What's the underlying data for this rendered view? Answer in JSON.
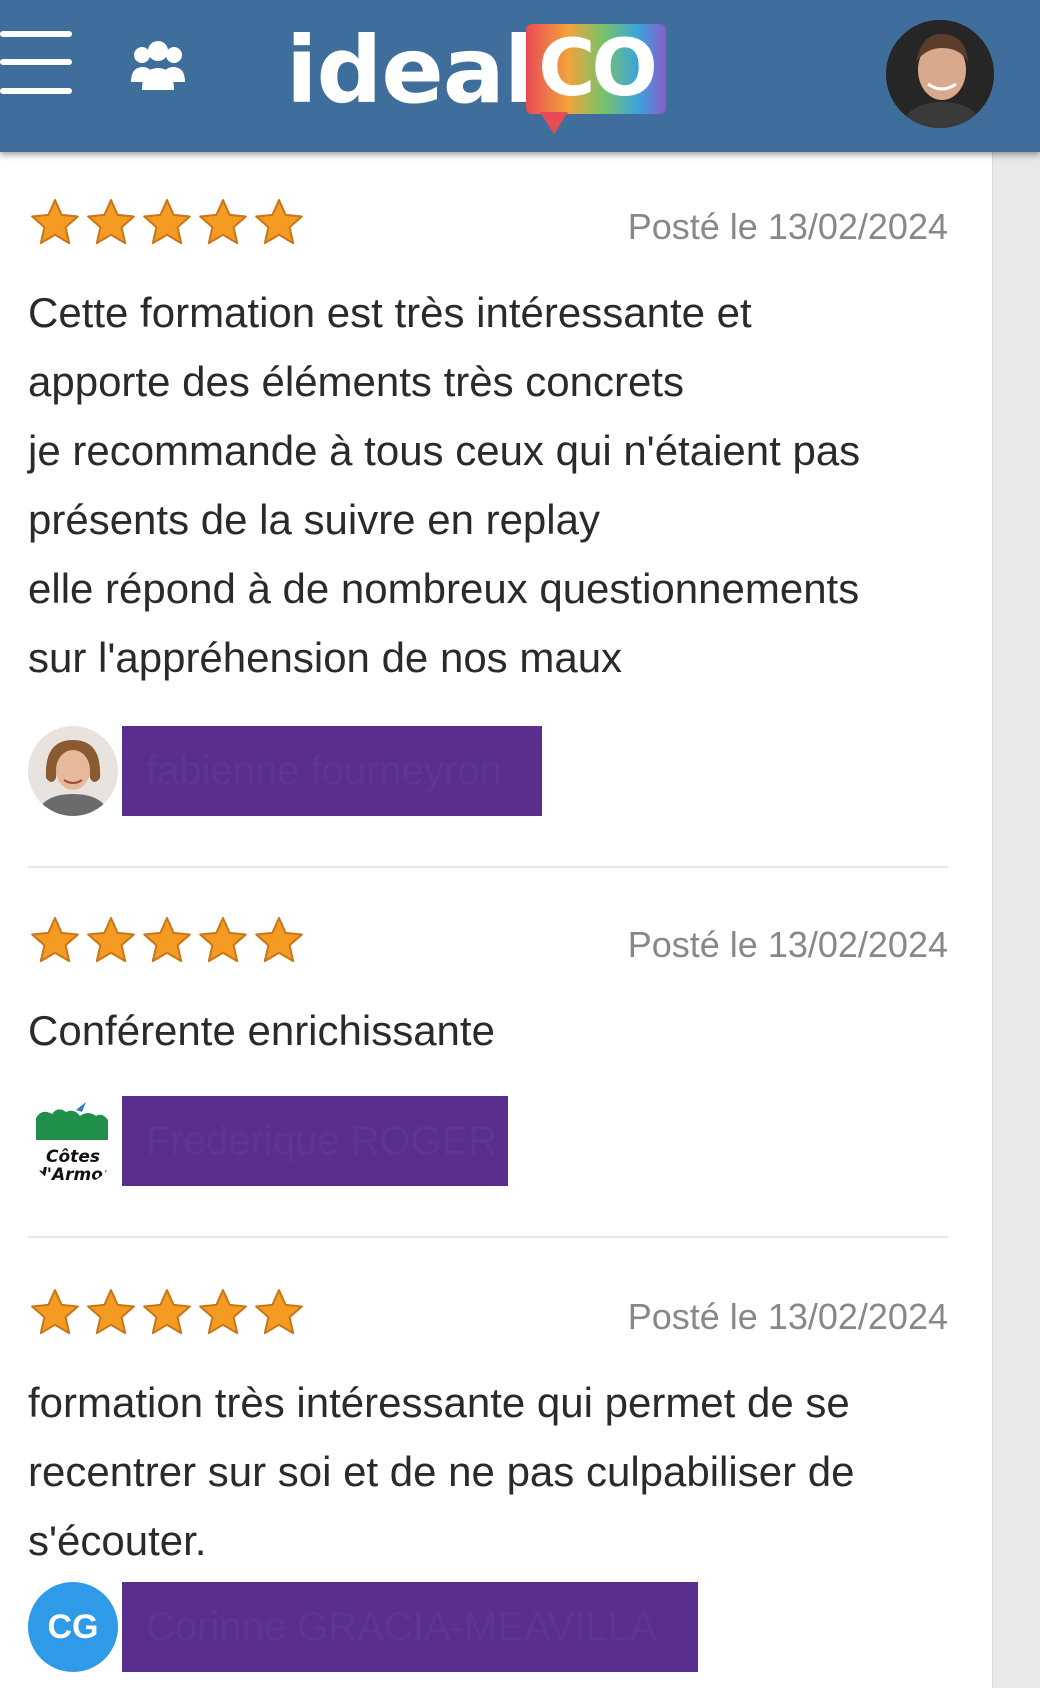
{
  "header": {
    "logo_word": "ideal",
    "logo_badge": "CO"
  },
  "colors": {
    "header_bg": "#3f6e9c",
    "star": "#f59a23",
    "redaction": "#5a2e8f",
    "initials_avatar": "#2f9be8"
  },
  "reviews": [
    {
      "rating": 5,
      "date": "Posté le 13/02/2024",
      "lines": [
        "Cette formation est très intéressante et",
        "apporte des éléments très concrets",
        "je recommande à tous ceux qui n'étaient pas",
        "présents de la suivre en replay",
        "elle répond à de nombreux questionnements",
        "sur l'appréhension de nos maux"
      ],
      "author": "fabienne fourneyron"
    },
    {
      "rating": 5,
      "date": "Posté le 13/02/2024",
      "lines": [
        "Conférente enrichissante"
      ],
      "author_logo_text": [
        "Côtes",
        "d'Armor"
      ],
      "author": "Frederique ROGER"
    },
    {
      "rating": 5,
      "date": "Posté le 13/02/2024",
      "lines": [
        "formation très intéressante qui permet de se",
        "recentrer sur soi et de ne pas culpabiliser de",
        "s'écouter."
      ],
      "author_initials": "CG",
      "author": "Corinne GRACIA-MEAVILLA"
    }
  ]
}
